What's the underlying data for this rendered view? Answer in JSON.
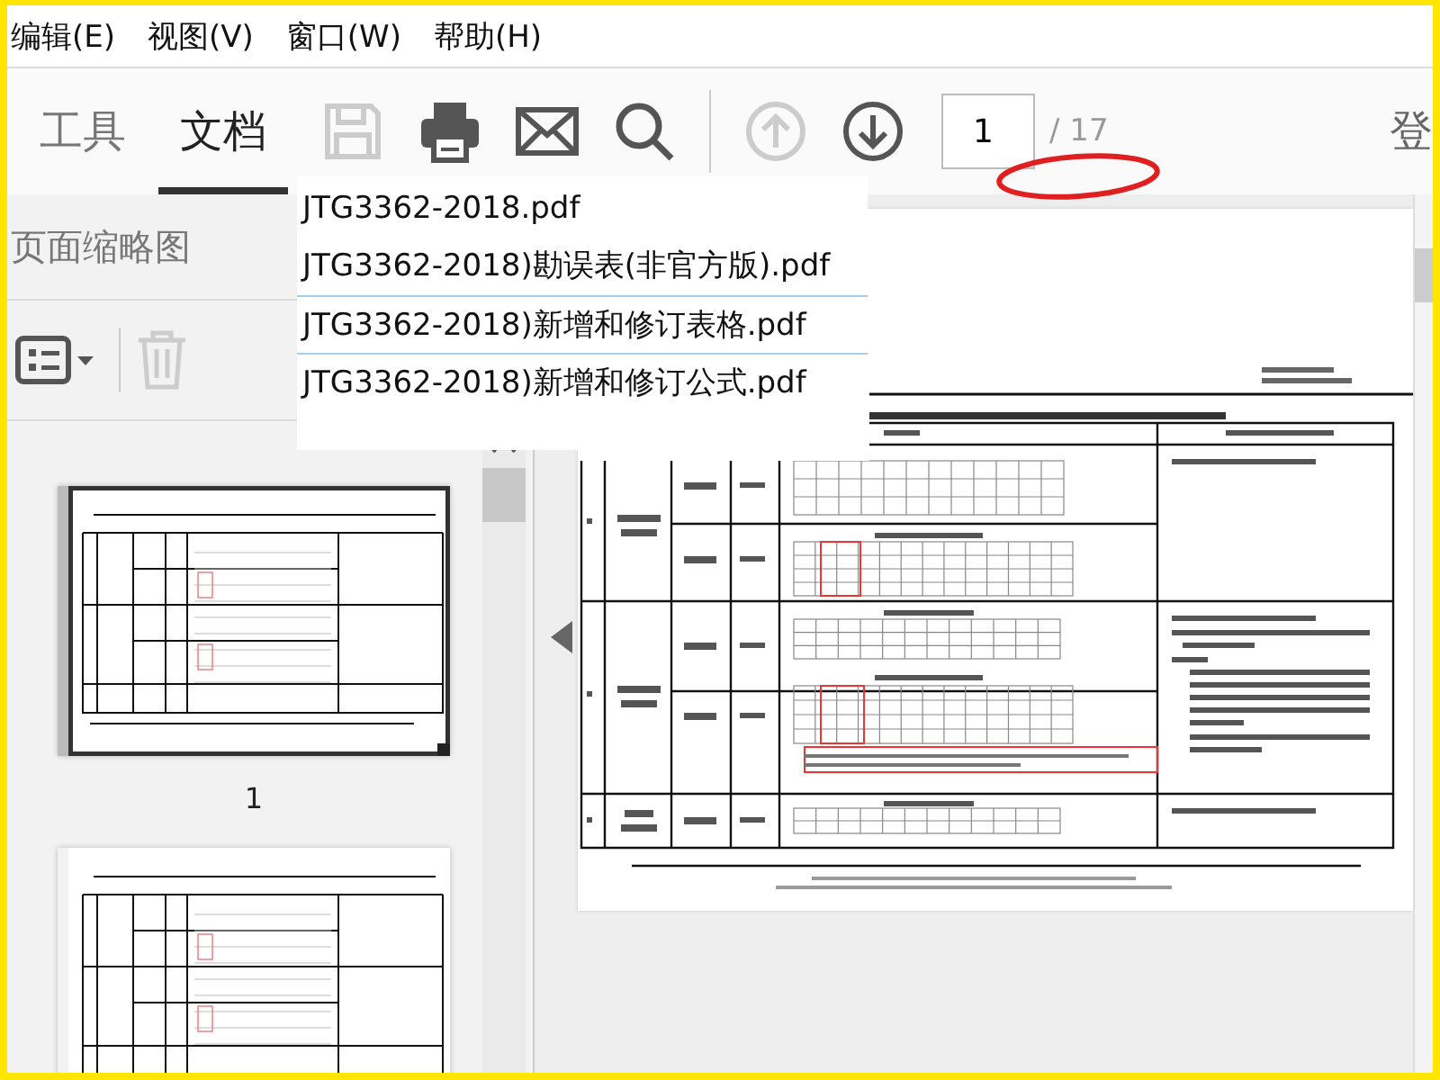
{
  "menu": [
    {
      "label": "编辑(E)"
    },
    {
      "label": "视图(V)"
    },
    {
      "label": "窗口(W)"
    },
    {
      "label": "帮助(H)"
    }
  ],
  "toolbar": {
    "tabs": [
      {
        "label": "工具",
        "selected": false
      },
      {
        "label": "文档",
        "selected": true
      }
    ],
    "buttons": [
      {
        "kind": "save",
        "disabled": true
      },
      {
        "kind": "print",
        "disabled": false
      },
      {
        "kind": "mail",
        "disabled": false
      },
      {
        "kind": "search",
        "disabled": false
      },
      {
        "kind": "prev-page",
        "disabled": true
      },
      {
        "kind": "next-page",
        "disabled": false
      }
    ],
    "page_input": {
      "value": "1"
    },
    "page_total": "/ 17",
    "sign_in": "登"
  },
  "dropdown": {
    "items": [
      {
        "label": "JTG3362-2018.pdf"
      },
      {
        "label": "JTG3362-2018)勘误表(非官方版).pdf"
      },
      {
        "label": "JTG3362-2018)新增和修订表格.pdf"
      },
      {
        "label": "JTG3362-2018)新增和修订公式.pdf"
      }
    ]
  },
  "sidebar": {
    "title": "页面缩略图",
    "tools": [
      {
        "kind": "options",
        "disabled": false
      },
      {
        "kind": "delete",
        "disabled": true
      }
    ],
    "thumbnails": [
      {
        "label": "1",
        "selected": true
      },
      {
        "selected": false
      }
    ]
  }
}
